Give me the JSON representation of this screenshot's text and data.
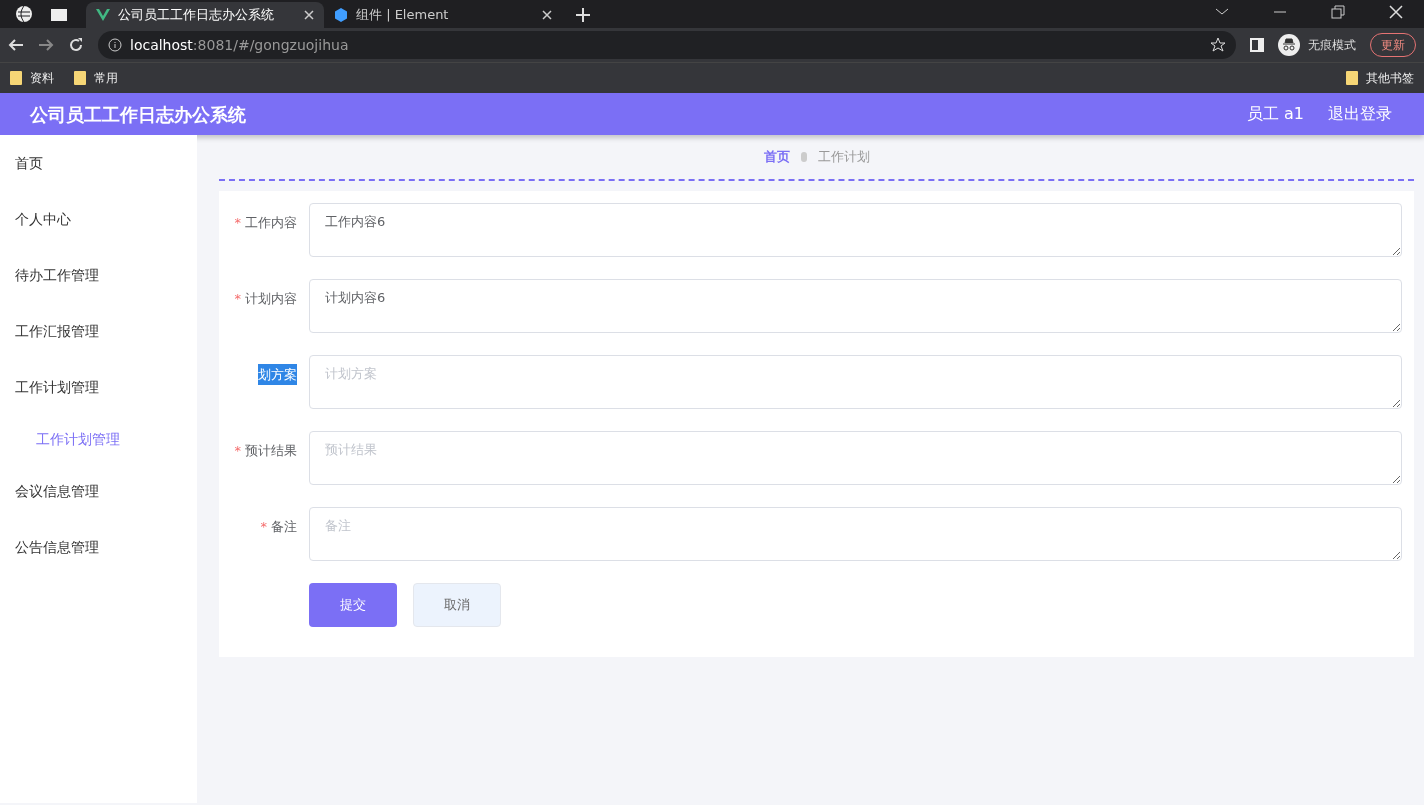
{
  "browser": {
    "tabs": [
      {
        "title": "公司员工工作日志办公系统",
        "selected": true,
        "kind": "vue"
      },
      {
        "title": "组件 | Element",
        "selected": false,
        "kind": "element"
      }
    ],
    "url_host": "localhost",
    "url_rest": ":8081/#/gongzuojihua",
    "incognito_label": "无痕模式",
    "update_button": "更新",
    "bookmarks": [
      "资料",
      "常用"
    ],
    "other_bookmarks": "其他书签"
  },
  "header": {
    "title": "公司员工工作日志办公系统",
    "user": "员工 a1",
    "logout": "退出登录"
  },
  "sidebar": {
    "items": [
      {
        "label": "首页"
      },
      {
        "label": "个人中心"
      },
      {
        "label": "待办工作管理"
      },
      {
        "label": "工作汇报管理"
      },
      {
        "label": "工作计划管理",
        "children": [
          {
            "label": "工作计划管理",
            "selected": true
          }
        ]
      },
      {
        "label": "会议信息管理"
      },
      {
        "label": "公告信息管理"
      }
    ]
  },
  "breadcrumb": [
    "首页",
    "工作计划"
  ],
  "form": {
    "fields": [
      {
        "required_mark": "*",
        "label": "工作内容",
        "highlighted": false,
        "value": "工作内容6"
      },
      {
        "required_mark": "*",
        "label": "计划内容",
        "highlighted": false,
        "value": "计划内容6"
      },
      {
        "label": "划方案",
        "highlighted": true,
        "placeholder": "计划方案"
      },
      {
        "required_mark": "*",
        "label": "预计结果",
        "highlighted": false,
        "placeholder": "预计结果"
      },
      {
        "required_mark": "*",
        "label": "备注",
        "highlighted": false,
        "placeholder": "备注"
      }
    ],
    "submit": "提交",
    "cancel": "取消"
  }
}
